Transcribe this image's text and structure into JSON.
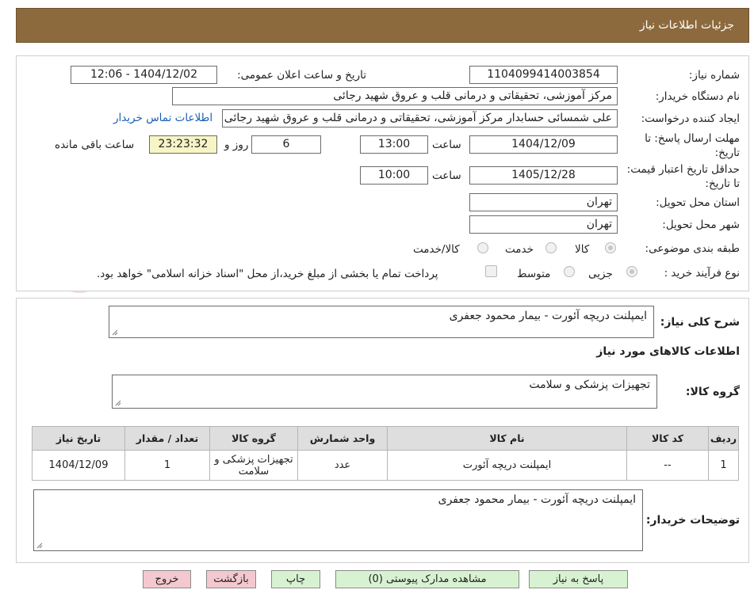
{
  "header": {
    "title": "جزئیات اطلاعات نیاز"
  },
  "fields": {
    "need_number_label": "شماره نیاز:",
    "need_number": "1104099414003854",
    "announce_label": "تاریخ و ساعت اعلان عمومی:",
    "announce_value": "1404/12/02 - 12:06",
    "buyer_org_label": "نام دستگاه خریدار:",
    "buyer_org": "مرکز آموزشی، تحقیقاتی و درمانی قلب و عروق شهید رجائی",
    "requester_label": "ایجاد کننده درخواست:",
    "requester": "علی شمسائی حسابدار مرکز آموزشی، تحقیقاتی و درمانی قلب و عروق شهید رجائی",
    "contact_link": "اطلاعات تماس خریدار",
    "deadline_label": "مهلت ارسال پاسخ: تا تاریخ:",
    "deadline_date": "1404/12/09",
    "time_label": "ساعت",
    "deadline_time": "13:00",
    "days_value": "6",
    "days_label": "روز و",
    "remaining_time": "23:23:32",
    "remaining_label": "ساعت باقی مانده",
    "validity_label": "حداقل تاریخ اعتبار قیمت: تا تاریخ:",
    "validity_date": "1405/12/28",
    "validity_time": "10:00",
    "province_label": "استان محل تحویل:",
    "province": "تهران",
    "city_label": "شهر محل تحویل:",
    "city": "تهران",
    "category_label": "طبقه بندی موضوعی:",
    "category_options": [
      "کالا",
      "خدمت",
      "کالا/خدمت"
    ],
    "process_label": "نوع فرآیند خرید :",
    "process_options": [
      "جزیی",
      "متوسط"
    ],
    "payment_note": "پرداخت تمام یا بخشی از مبلغ خرید،از محل \"اسناد خزانه اسلامی\" خواهد بود."
  },
  "summary": {
    "label": "شرح کلی نیاز:",
    "value": "ایمپلنت دریچه آئورت - بیمار محمود جعفری",
    "goods_info_title": "اطلاعات کالاهای مورد نیاز",
    "goods_group_label": "گروه کالا:",
    "goods_group": "تجهیزات پزشکی و سلامت"
  },
  "table": {
    "headers": [
      "ردیف",
      "کد کالا",
      "نام کالا",
      "واحد شمارش",
      "گروه کالا",
      "تعداد / مقدار",
      "تاریخ نیاز"
    ],
    "rows": [
      [
        "1",
        "--",
        "ایمپلنت دریچه آئورت",
        "عدد",
        "تجهیزات پزشکی و سلامت",
        "1",
        "1404/12/09"
      ]
    ]
  },
  "buyer_notes": {
    "label": "توضیحات خریدار:",
    "value": "ایمپلنت دریچه آئورت - بیمار محمود جعفری"
  },
  "buttons": {
    "reply": "پاسخ به نیاز",
    "attachments": "مشاهده مدارک پیوستی (0)",
    "print": "چاپ",
    "back": "بازگشت",
    "exit": "خروج"
  },
  "colors": {
    "header_bg": "#8c6a3d",
    "green_button": "#d7f2d0",
    "pink_button": "#f4c8cf",
    "timer_bg": "#f7f4c6"
  }
}
